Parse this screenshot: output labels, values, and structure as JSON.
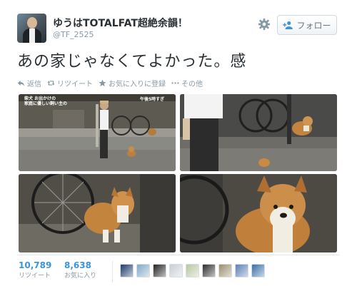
{
  "user": {
    "display_name": "ゆうはTOTALFAT超絶余韻！",
    "handle": "@TF_2525"
  },
  "header": {
    "follow_label": "フォロー",
    "icons": [
      "gear-icon",
      "follow-person-icon"
    ]
  },
  "tweet": {
    "text": "あの家じゃなくてよかった。感"
  },
  "actions": [
    {
      "icon": "reply-icon",
      "label": "返信"
    },
    {
      "icon": "retweet-icon",
      "label": "リツイート"
    },
    {
      "icon": "star-icon",
      "label": "お気に入りに登録"
    },
    {
      "icon": "more-icon",
      "label": "その他"
    }
  ],
  "photos": {
    "photo1_caption_line1": "柴犬 お出かけの",
    "photo1_caption_line2": "家庭に優しい飼い主の",
    "photo1_caption_line3": "午後5時すぎ",
    "alt": [
      "man-walking-with-corgi",
      "corgi-by-bicycle",
      "corgi-behind-bicycle-wheel",
      "corgi-closeup"
    ]
  },
  "stats": {
    "retweets_count": "10,789",
    "retweets_label": "リツイート",
    "favorites_count": "8,638",
    "favorites_label": "お気に入り"
  },
  "favoriters": {
    "count_shown": 9,
    "colors": [
      "#1f3a6b",
      "#7fa9c9",
      "#222222",
      "#c9cfd6",
      "#b8c7a0",
      "#2d2d2d",
      "#9a8e6a",
      "#5b7fb7",
      "#3b6fa8"
    ]
  },
  "colors": {
    "link": "#3b94d9",
    "muted": "#8899a6",
    "text": "#292f33",
    "border": "#e1e8ed"
  }
}
